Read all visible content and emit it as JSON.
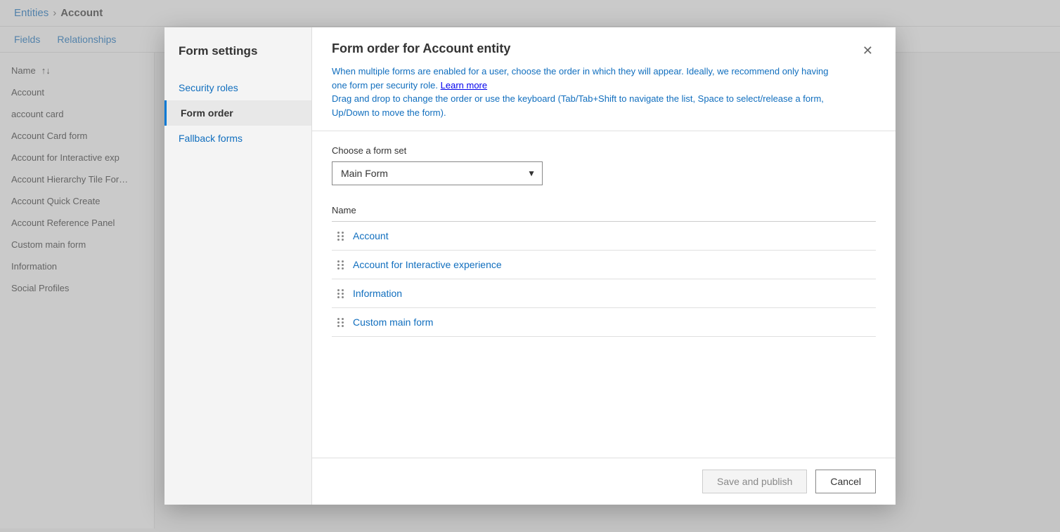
{
  "breadcrumb": {
    "entities_label": "Entities",
    "chevron": "›",
    "account_label": "Account"
  },
  "bg_nav": {
    "fields_label": "Fields",
    "relationships_label": "Relationships"
  },
  "bg_sidebar": {
    "sort_label": "Name",
    "sort_icon": "↑↓",
    "items": [
      {
        "label": "Account",
        "active": false
      },
      {
        "label": "account card",
        "active": false
      },
      {
        "label": "Account Card form",
        "active": false
      },
      {
        "label": "Account for Interactive exp",
        "active": false
      },
      {
        "label": "Account Hierarchy Tile For…",
        "active": false
      },
      {
        "label": "Account Quick Create",
        "active": false
      },
      {
        "label": "Account Reference Panel",
        "active": false
      },
      {
        "label": "Custom main form",
        "active": false
      },
      {
        "label": "Information",
        "active": false
      },
      {
        "label": "Social Profiles",
        "active": false
      }
    ]
  },
  "modal": {
    "left_title": "Form settings",
    "nav_items": [
      {
        "label": "Security roles",
        "active": false
      },
      {
        "label": "Form order",
        "active": true
      },
      {
        "label": "Fallback forms",
        "active": false
      }
    ],
    "title": "Form order for Account entity",
    "desc_part1": "When multiple forms are enabled for a user, choose the order in which they will appear. Ideally, we recommend only having one form per security role.",
    "learn_more": "Learn more",
    "desc_part2": "Drag and drop to change the order or use the keyboard (Tab/Tab+Shift to navigate the list, Space to",
    "select_label": "select/release a form, Up/Down to",
    "move_label": "move the form).",
    "choose_label": "Choose a form set",
    "dropdown_value": "Main Form",
    "list_header": "Name",
    "list_items": [
      {
        "name": "Account"
      },
      {
        "name": "Account for Interactive experience"
      },
      {
        "name": "Information"
      },
      {
        "name": "Custom main form"
      }
    ],
    "save_label": "Save and publish",
    "cancel_label": "Cancel",
    "close_icon": "✕"
  }
}
